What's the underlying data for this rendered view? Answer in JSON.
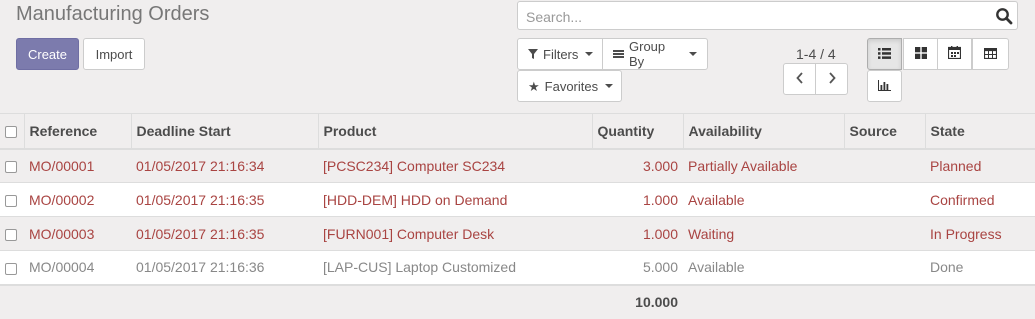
{
  "page": {
    "title": "Manufacturing Orders"
  },
  "actions": {
    "create_label": "Create",
    "import_label": "Import"
  },
  "search": {
    "placeholder": "Search...",
    "icon": "search-icon"
  },
  "filters": {
    "filters_label": "Filters",
    "groupby_label": "Group By",
    "favorites_label": "Favorites"
  },
  "pager": {
    "value": "1-4 / 4"
  },
  "views": {
    "active": "list",
    "items": [
      "list",
      "kanban",
      "calendar",
      "pivot",
      "graph"
    ]
  },
  "table": {
    "headers": {
      "reference": "Reference",
      "deadline": "Deadline Start",
      "product": "Product",
      "quantity": "Quantity",
      "availability": "Availability",
      "source": "Source",
      "state": "State"
    },
    "rows": [
      {
        "reference": "MO/00001",
        "deadline": "01/05/2017 21:16:34",
        "product": "[PCSC234] Computer SC234",
        "quantity": "3.000",
        "availability": "Partially Available",
        "source": "",
        "state": "Planned"
      },
      {
        "reference": "MO/00002",
        "deadline": "01/05/2017 21:16:35",
        "product": "[HDD-DEM] HDD on Demand",
        "quantity": "1.000",
        "availability": "Available",
        "source": "",
        "state": "Confirmed"
      },
      {
        "reference": "MO/00003",
        "deadline": "01/05/2017 21:16:35",
        "product": "[FURN001] Computer Desk",
        "quantity": "1.000",
        "availability": "Waiting",
        "source": "",
        "state": "In Progress"
      },
      {
        "reference": "MO/00004",
        "deadline": "01/05/2017 21:16:36",
        "product": "[LAP-CUS] Laptop Customized",
        "quantity": "5.000",
        "availability": "Available",
        "source": "",
        "state": "Done"
      }
    ],
    "total_quantity": "10.000"
  },
  "colors": {
    "primary": "#7c7bad",
    "late_text": "#a94442",
    "done_text": "#888888"
  }
}
